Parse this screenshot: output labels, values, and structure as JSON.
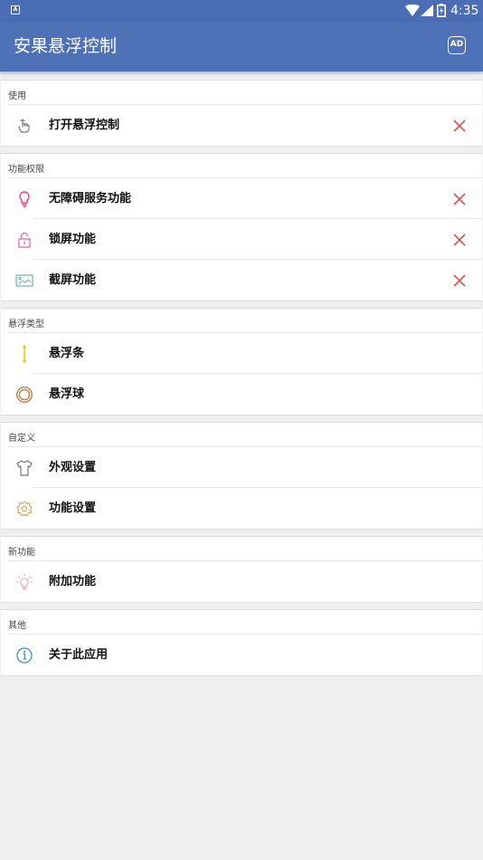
{
  "status_bar": {
    "time": "4:35",
    "notification_glyph": "A"
  },
  "app_bar": {
    "title": "安果悬浮控制",
    "ad_label": "AD"
  },
  "sections": {
    "use": {
      "header": "使用",
      "items": [
        {
          "label": "打开悬浮控制",
          "icon": "hand-pointer-icon"
        }
      ]
    },
    "permissions": {
      "header": "功能权限",
      "items": [
        {
          "label": "无障碍服务功能",
          "icon": "lightbulb-icon"
        },
        {
          "label": "锁屏功能",
          "icon": "lock-icon"
        },
        {
          "label": "截屏功能",
          "icon": "image-icon"
        }
      ]
    },
    "float_type": {
      "header": "悬浮类型",
      "items": [
        {
          "label": "悬浮条",
          "icon": "vertical-bar-icon"
        },
        {
          "label": "悬浮球",
          "icon": "circle-ball-icon"
        }
      ]
    },
    "custom": {
      "header": "自定义",
      "items": [
        {
          "label": "外观设置",
          "icon": "shirt-icon"
        },
        {
          "label": "功能设置",
          "icon": "gear-icon"
        }
      ]
    },
    "new_features": {
      "header": "新功能",
      "items": [
        {
          "label": "附加功能",
          "icon": "bulb-sparkle-icon"
        }
      ]
    },
    "other": {
      "header": "其他",
      "items": [
        {
          "label": "关于此应用",
          "icon": "info-icon"
        }
      ]
    }
  },
  "colors": {
    "appbar": "#4e71b8",
    "statusbar": "#4a6db5",
    "close_red": "#e04d4d",
    "background": "#efefef"
  }
}
